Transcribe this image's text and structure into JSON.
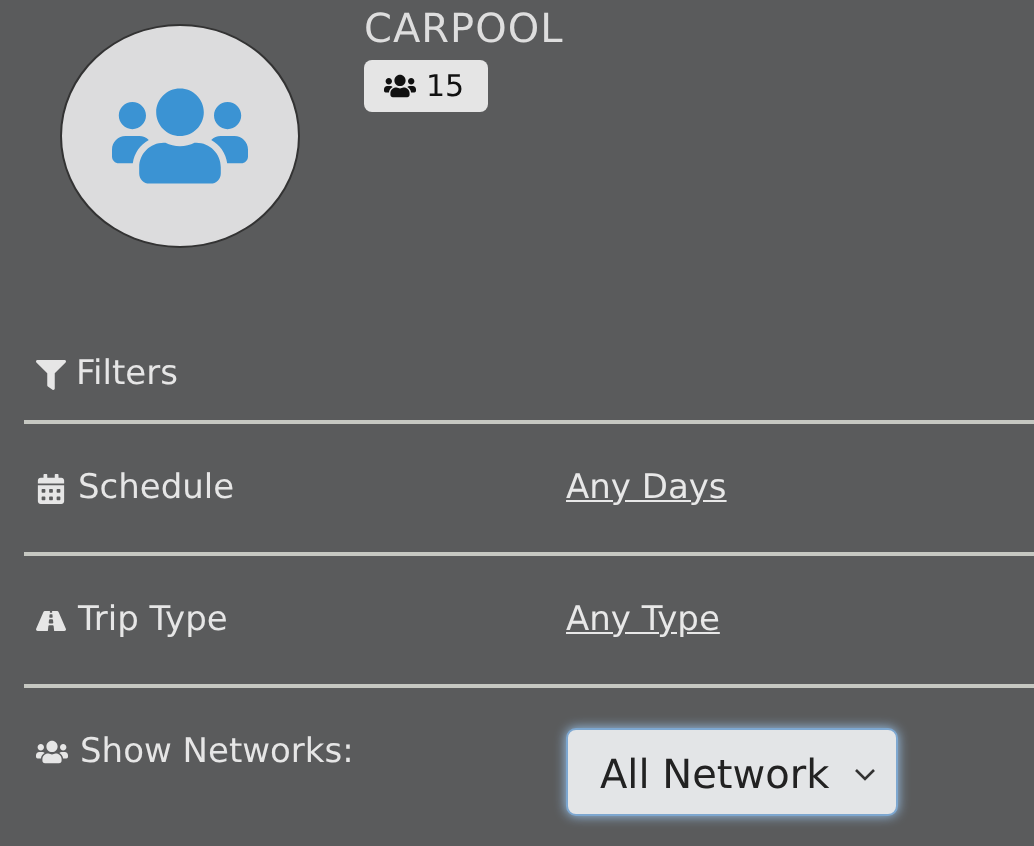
{
  "group": {
    "title": "CARPOOL",
    "member_count": "15"
  },
  "filters": {
    "heading": "Filters",
    "rows": [
      {
        "kind": "link",
        "label": "Schedule",
        "value": "Any Days"
      },
      {
        "kind": "link",
        "label": "Trip Type",
        "value": "Any Type"
      },
      {
        "kind": "select",
        "label": "Show Networks:",
        "value": "All Network"
      }
    ]
  }
}
